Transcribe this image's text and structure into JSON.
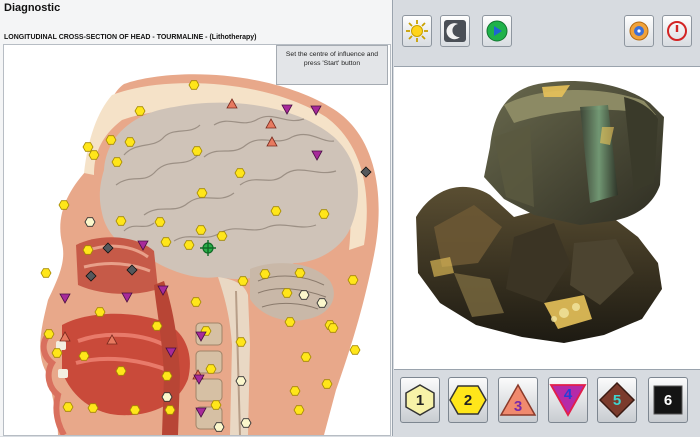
{
  "window_title": "Diagnostic",
  "section_title": "LONGITUDINAL CROSS-SECTION OF HEAD - TOURMALINE - (Lithotherapy)",
  "hint_text": "Set the centre of influence and press 'Start' button",
  "toolbar": {
    "icons": [
      "sun-icon",
      "moon-icon",
      "play-icon",
      "music-icon",
      "power-icon"
    ]
  },
  "levels": [
    {
      "label": "1",
      "shape": "hexagon",
      "fill": "#f7f2a8",
      "text": "#222222"
    },
    {
      "label": "2",
      "shape": "hexagon",
      "fill": "#ffe61a",
      "text": "#222222"
    },
    {
      "label": "3",
      "shape": "triangle-up",
      "fill": "#f08a6e",
      "text": "#7a2aa8"
    },
    {
      "label": "4",
      "shape": "triangle-down",
      "fill": "#b52aa8",
      "text": "#2540d8"
    },
    {
      "label": "5",
      "shape": "diamond",
      "fill": "#7b3b2c",
      "text": "#3ed6d0"
    },
    {
      "label": "6",
      "shape": "square",
      "fill": "#141414",
      "text": "#ffffff"
    }
  ],
  "colors": {
    "level1": "#f7f2a8",
    "level2": "#ffe61a",
    "level3": "#e77a60",
    "level4": "#a72a9a",
    "level5": "#55585c",
    "target": "#2bb14a"
  }
}
